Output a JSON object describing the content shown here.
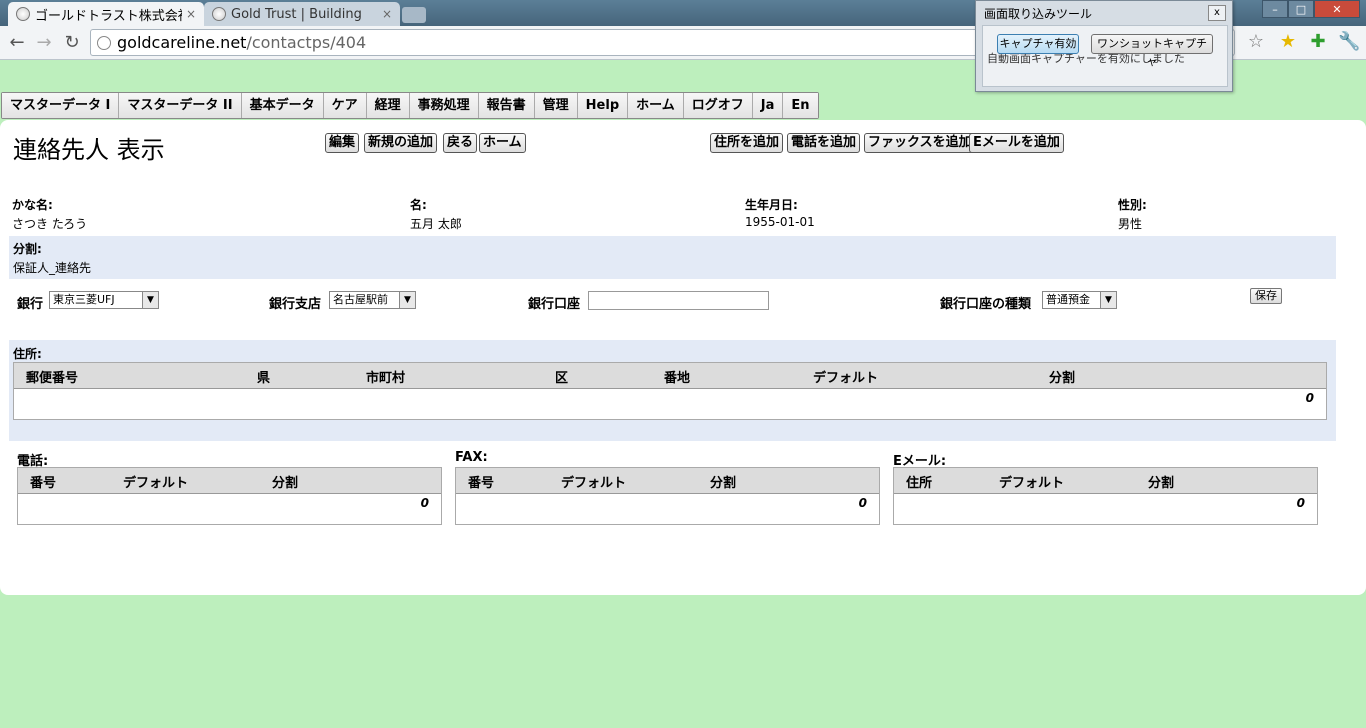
{
  "browser": {
    "tabs": [
      {
        "label": "ゴールドトラスト株式会社"
      },
      {
        "label": "Gold Trust | Building"
      }
    ],
    "url_host": "goldcareline.net",
    "url_path": "/contactps/404"
  },
  "capture_tool": {
    "title": "画面取り込みツール",
    "close": "x",
    "capture_enabled": "キャプチャ有効",
    "one_shot": "ワンショットキャプチャ",
    "message": "自動画面キャプチャーを有効にしました"
  },
  "menu": [
    "マスターデータ I",
    "マスターデータ II",
    "基本データ",
    "ケア",
    "経理",
    "事務処理",
    "報告書",
    "管理",
    "Help",
    "ホーム",
    "ログオフ",
    "Ja",
    "En"
  ],
  "page": {
    "title": "連絡先人 表示",
    "actions": {
      "edit": "編集",
      "new": "新規の追加",
      "back": "戻る",
      "home": "ホーム"
    },
    "add_actions": {
      "address": "住所を追加",
      "phone": "電話を追加",
      "fax": "ファックスを追加",
      "email": "Eメールを追加"
    }
  },
  "person": {
    "kana_label": "かな名:",
    "kana_value": "さつき たろう",
    "name_label": "名:",
    "name_value": "五月 太郎",
    "dob_label": "生年月日:",
    "dob_value": "1955-01-01",
    "gender_label": "性別:",
    "gender_value": "男性",
    "division_label": "分割:",
    "division_value": "保証人_連絡先"
  },
  "bank": {
    "bank_label": "銀行",
    "bank_value": "東京三菱UFJ",
    "branch_label": "銀行支店",
    "branch_value": "名古屋駅前",
    "account_label": "銀行口座",
    "account_value": "",
    "type_label": "銀行口座の種類",
    "type_value": "普通預金",
    "save": "保存"
  },
  "address": {
    "label": "住所:",
    "columns": [
      "郵便番号",
      "県",
      "市町村",
      "区",
      "番地",
      "デフォルト",
      "分割"
    ],
    "count": "0"
  },
  "phone": {
    "label": "電話:",
    "columns": [
      "番号",
      "デフォルト",
      "分割"
    ],
    "count": "0"
  },
  "fax": {
    "label": "FAX:",
    "columns": [
      "番号",
      "デフォルト",
      "分割"
    ],
    "count": "0"
  },
  "email": {
    "label": "Eメール:",
    "columns": [
      "住所",
      "デフォルト",
      "分割"
    ],
    "count": "0"
  }
}
